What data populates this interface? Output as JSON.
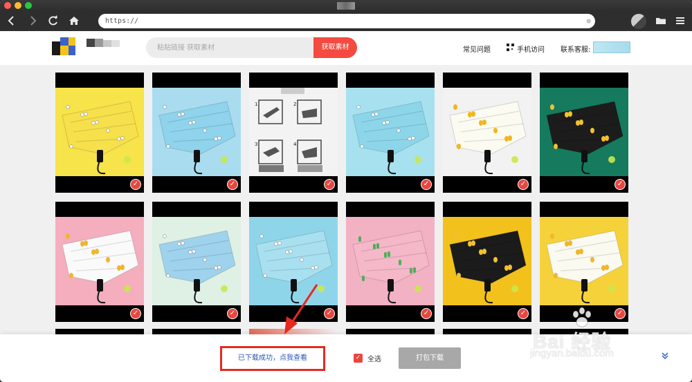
{
  "browser": {
    "url": "https://",
    "url_clear_icon": "x-icon"
  },
  "header": {
    "search_placeholder": "粘贴链接 获取素材",
    "search_button": "获取素材",
    "faq": "常见问题",
    "mobile": "手机访问",
    "support": "联系客服:"
  },
  "products": [
    {
      "bg": "#f7e34a",
      "canopy": "#f6e04c",
      "accent": "#ffffff",
      "pattern": "penguin"
    },
    {
      "bg": "#a9dcef",
      "canopy": "#8fd3ec",
      "accent": "#ffffff",
      "pattern": "penguin"
    },
    {
      "bg": "#f3f3f3",
      "canopy": "#ffffff",
      "accent": "#555555",
      "pattern": "diagram"
    },
    {
      "bg": "#a7e1ef",
      "canopy": "#8dd6ea",
      "accent": "#ffffff",
      "pattern": "cat"
    },
    {
      "bg": "#f2f2f2",
      "canopy": "#fbfbf2",
      "accent": "#f2b61e",
      "pattern": "pineapple"
    },
    {
      "bg": "#157a5e",
      "canopy": "#1c1c1c",
      "accent": "#f2c12e",
      "pattern": "pineapple"
    },
    {
      "bg": "#f4aebe",
      "canopy": "#fafafa",
      "accent": "#f0b630",
      "pattern": "pineapple"
    },
    {
      "bg": "#dff0e4",
      "canopy": "#9fd2ec",
      "accent": "#ffffff",
      "pattern": "cat"
    },
    {
      "bg": "#8fd5ea",
      "canopy": "#a8e0f0",
      "accent": "#ffffff",
      "pattern": "cat"
    },
    {
      "bg": "#f3b1c4",
      "canopy": "#f4b8c8",
      "accent": "#4fae5a",
      "pattern": "cactus"
    },
    {
      "bg": "#f3c11c",
      "canopy": "#1b1b1b",
      "accent": "#f2c12e",
      "pattern": "pineapple"
    },
    {
      "bg": "#f6d23a",
      "canopy": "#fafaf0",
      "accent": "#f0b630",
      "pattern": "pineapple"
    }
  ],
  "footer": {
    "download_success": "已下载成功，点我查看",
    "select_all": "全选",
    "select_all_checked": true,
    "pack_download": "打包下载",
    "expand_icon": "double-chevron-down-icon"
  },
  "watermark": {
    "logo": "Bai 经验",
    "url": "jingyan.baidu.com"
  },
  "colors": {
    "accent_red": "#f44a3f",
    "link_blue": "#2b57b8",
    "annotation_red": "#e8291f"
  }
}
